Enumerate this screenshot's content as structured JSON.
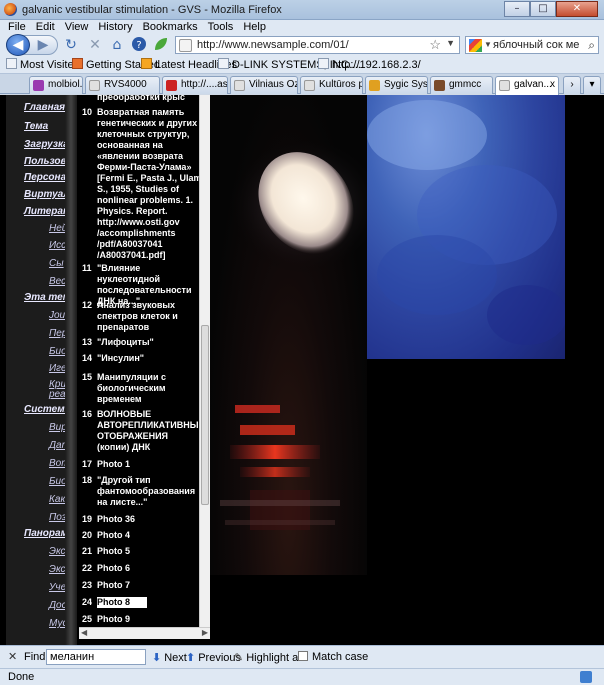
{
  "window": {
    "title": "galvanic vestibular stimulation - GVS - Mozilla Firefox",
    "btn_min": "–",
    "btn_max": "□",
    "btn_close": "✕"
  },
  "menu": [
    "File",
    "Edit",
    "View",
    "History",
    "Bookmarks",
    "Tools",
    "Help"
  ],
  "nav": {
    "url": "http://www.newsample.com/01/",
    "search_value": "яблочный сок ме",
    "back_glyph": "◀",
    "forward_glyph": "▶",
    "reload_glyph": "↻",
    "stop_glyph": "✕",
    "home_glyph": "⌂"
  },
  "bookmarks": [
    "Most Visited",
    "Getting Started",
    "Latest Headlines",
    "D-LINK SYSTEMS, INC....",
    "http://192.168.2.3/"
  ],
  "tabs": [
    {
      "label": "molbiol.ru ...",
      "color": "#9a3ab0"
    },
    {
      "label": "RVS4000",
      "color": "#e0e0e0"
    },
    {
      "label": "http://....aspx",
      "color": "#cc2222"
    },
    {
      "label": "Vilniaus Oz...",
      "color": "#e0e0e0"
    },
    {
      "label": "Kultūros p...",
      "color": "#e0e0e0"
    },
    {
      "label": "Sygic Syste...",
      "color": "#e0a020"
    },
    {
      "label": "gmmcc",
      "color": "#7a4b2a"
    },
    {
      "label": "galvan...",
      "color": "#e0e0e0",
      "close": "x"
    }
  ],
  "leftnav": [
    "Главная стр",
    "Тема",
    "Загрузка",
    "Пользова",
    "Персонал",
    "Виртуал",
    "Литерат",
    "Ней",
    "Исс",
    "Сы",
    "Вес",
    "Эта тем",
    "Jou",
    "Пер",
    "Био",
    "Иге",
    "Кри",
    "реа",
    "Системн",
    "Вир",
    "Дат",
    "Вот",
    "Био",
    "Как",
    "Поз",
    "Панорам",
    "Экс",
    "Экс",
    "Уче",
    "Дос",
    "Мус"
  ],
  "list": {
    "top_fragment": "преобработки крыс",
    "items": [
      {
        "n": "10",
        "text": "Возвратная память генетических и других клеточных структур, основанная на «явлении возврата Ферми-Паста-Улама» [Fermi E., Pasta J., Ulam S., 1955, Studies of nonlinear problems. 1. Physics. Report. http://www.osti.gov /accomplishments /pdf/A80037041 /A80037041.pdf]"
      },
      {
        "n": "11",
        "text": "\"Влияние нуклеотидной последовательности ДНК на...\""
      },
      {
        "n": "12",
        "text": "Анализ звуковых спектров клеток и препаратов"
      },
      {
        "n": "13",
        "text": "\"Лифоциты\""
      },
      {
        "n": "14",
        "text": "\"Инсулин\""
      },
      {
        "n": "15",
        "text": "Манипуляции с биологическим временем"
      },
      {
        "n": "16",
        "text": "ВОЛНОВЫЕ АВТОРЕПЛИКАТИВНЫЕ ОТОБРАЖЕНИЯ (копии) ДНК"
      },
      {
        "n": "17",
        "text": "Photo 1"
      },
      {
        "n": "18",
        "text": "\"Другой тип фантомообразования на листе...\""
      },
      {
        "n": "19",
        "text": "Photo 36"
      },
      {
        "n": "20",
        "text": "Photo 4"
      },
      {
        "n": "21",
        "text": "Photo 5"
      },
      {
        "n": "22",
        "text": "Photo 6"
      },
      {
        "n": "23",
        "text": "Photo 7"
      },
      {
        "n": "24",
        "text": "Photo 8"
      },
      {
        "n": "25",
        "text": "Photo 9"
      }
    ]
  },
  "find": {
    "close": "✕",
    "label": "Find:",
    "value": "меланин",
    "next": "Next",
    "previous": "Previous",
    "highlight": "Highlight all",
    "match_case": "Match case"
  },
  "status": "Done"
}
